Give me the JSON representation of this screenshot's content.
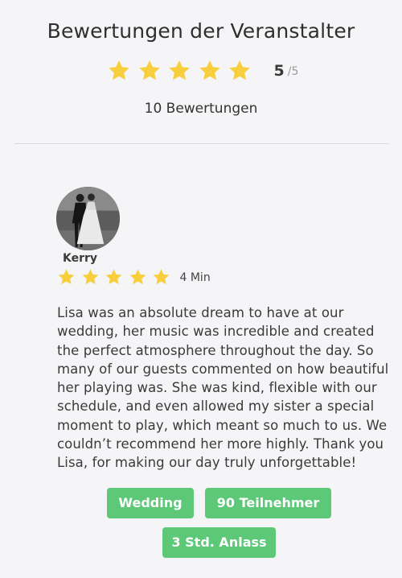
{
  "header": {
    "title": "Bewertungen der Veranstalter",
    "rating_stars": 5,
    "rating_score": "5",
    "rating_max": "/5",
    "review_count": "10 Bewertungen"
  },
  "review": {
    "reviewer_name": "Kerry",
    "stars": 5,
    "time_ago": "4 Min",
    "text": "Lisa was an absolute dream to have at our wedding, her music was incredible and created the perfect atmosphere throughout the day. So many of our guests commented on how beautiful her playing was. She was kind, flexible with our schedule, and even allowed my sister a special moment to play, which meant so much to us. We couldn’t recommend her more highly. Thank you Lisa, for making our day truly unforgettable!",
    "tags": [
      "Wedding",
      "90 Teilnehmer",
      "3 Std. Anlass"
    ]
  },
  "colors": {
    "star": "#f7cf3c",
    "tag_background": "#5cc878",
    "page_background": "#f5f5f7"
  },
  "icons": {
    "star": "star-icon",
    "avatar": "reviewer-photo"
  }
}
